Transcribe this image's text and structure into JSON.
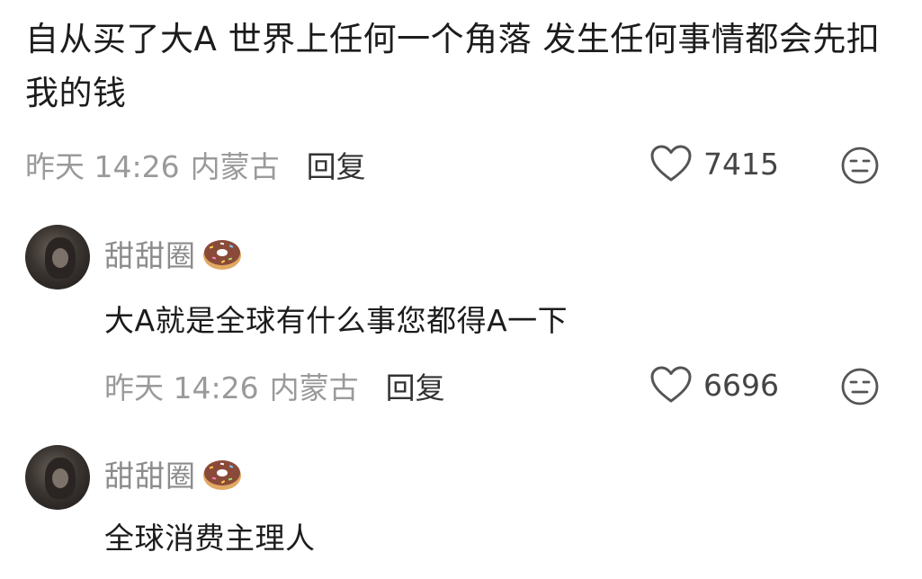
{
  "main_comment": {
    "text": "自从买了大A 世界上任何一个角落 发生任何事情都会先扣我的钱",
    "time": "昨天 14:26",
    "location": "内蒙古",
    "reply_label": "回复",
    "likes": "7415"
  },
  "replies": [
    {
      "username": "甜甜圈",
      "text": "大A就是全球有什么事您都得A一下",
      "time": "昨天 14:26",
      "location": "内蒙古",
      "reply_label": "回复",
      "likes": "6696"
    },
    {
      "username": "甜甜圈",
      "text": "全球消费主理人"
    }
  ],
  "icons": {
    "like": "heart-icon",
    "dislike": "neutral-face-icon",
    "badge": "donut-icon"
  },
  "colors": {
    "text": "#1c1c1c",
    "meta": "#9a9a9a",
    "username": "#8c8c8c",
    "donut_frosting": "#8a4a3a",
    "donut_dough": "#e0a862"
  }
}
